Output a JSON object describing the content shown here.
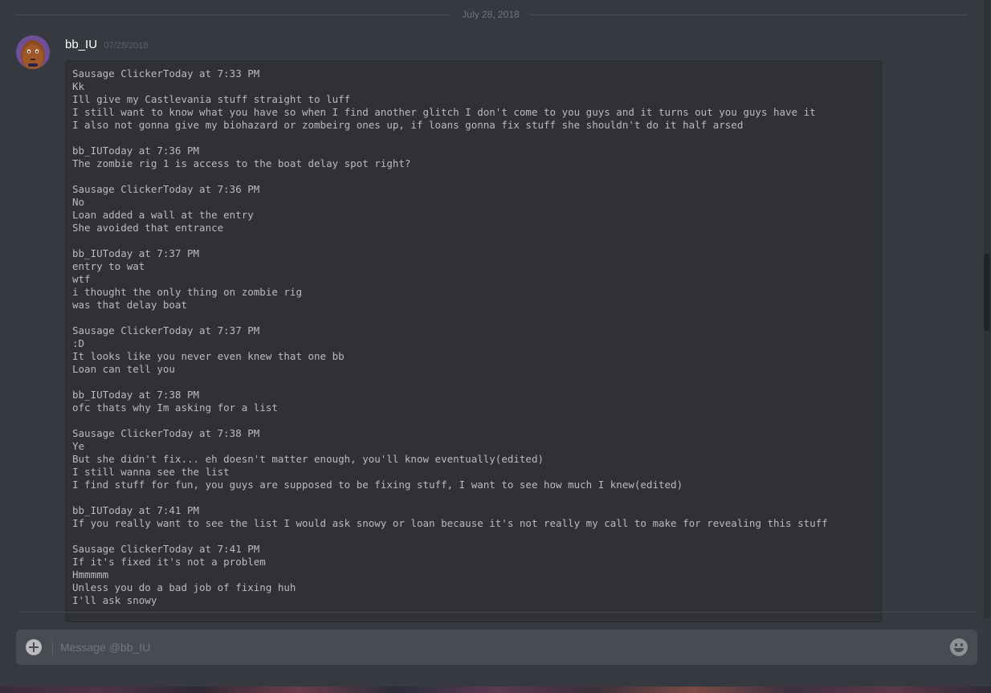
{
  "date_divider": "July 28, 2018",
  "message": {
    "author": "bb_IU",
    "timestamp": "07/28/2018",
    "code_lines": [
      "Sausage ClickerToday at 7:33 PM",
      "Kk",
      "Ill give my Castlevania stuff straight to luff",
      "I still want to know what you have so when I find another glitch I don't come to you guys and it turns out you guys have it",
      "I also not gonna give my biohazard or zombeirg ones up, if loans gonna fix stuff she shouldn't do it half arsed",
      "",
      "bb_IUToday at 7:36 PM",
      "The zombie rig 1 is access to the boat delay spot right?",
      "",
      "Sausage ClickerToday at 7:36 PM",
      "No",
      "Loan added a wall at the entry",
      "She avoided that entrance",
      "",
      "bb_IUToday at 7:37 PM",
      "entry to wat",
      "wtf",
      "i thought the only thing on zombie rig",
      "was that delay boat",
      "",
      "Sausage ClickerToday at 7:37 PM",
      ":D",
      "It looks like you never even knew that one bb",
      "Loan can tell you",
      "",
      "bb_IUToday at 7:38 PM",
      "ofc thats why Im asking for a list",
      "",
      "Sausage ClickerToday at 7:38 PM",
      "Ye",
      "But she didn't fix... eh doesn't matter enough, you'll know eventually(edited)",
      "I still wanna see the list",
      "I find stuff for fun, you guys are supposed to be fixing stuff, I want to see how much I knew(edited)",
      "",
      "bb_IUToday at 7:41 PM",
      "If you really want to see the list I would ask snowy or loan because it's not really my call to make for revealing this stuff",
      "",
      "Sausage ClickerToday at 7:41 PM",
      "If it's fixed it's not a problem",
      "Hmmmmm",
      "Unless you do a bad job of fixing huh",
      "I'll ask snowy"
    ]
  },
  "compose": {
    "placeholder": "Message @bb_IU",
    "attach_icon": "plus-circle-icon",
    "emoji_icon": "smiley-face-icon"
  },
  "colors": {
    "background": "#36393f",
    "code_background": "#2f3136",
    "compose_background": "#484b51",
    "author_name": "#ffffff",
    "muted_text": "#72767d"
  }
}
